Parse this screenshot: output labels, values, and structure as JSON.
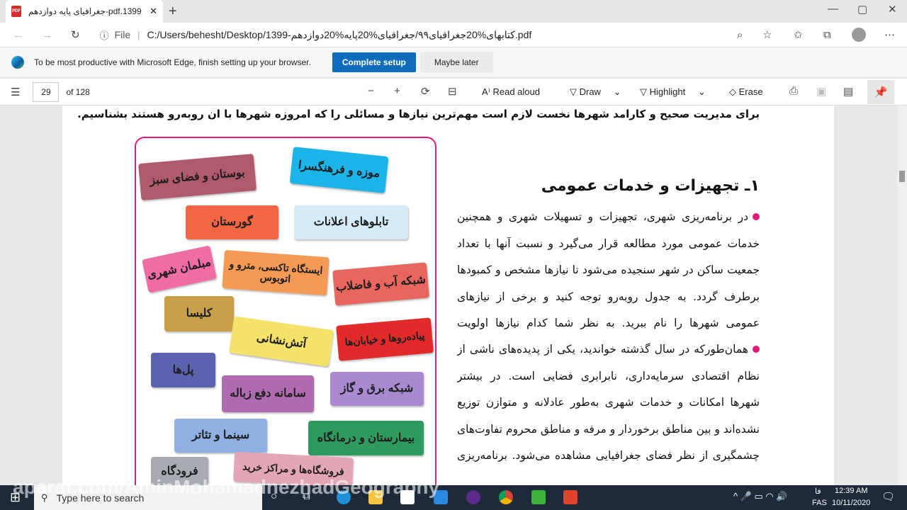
{
  "browser": {
    "tab_title": "جغرافیای پایه دوازدهم-pdf.1399",
    "url_scheme": "File",
    "url": "C:/Users/behesht/Desktop/1399-کتابهای%20جغرافیای۹۹/جغرافیای%20پایه%20دوازدهم.pdf"
  },
  "banner": {
    "text": "To be most productive with Microsoft Edge, finish setting up your browser.",
    "complete": "Complete setup",
    "later": "Maybe later"
  },
  "pdf": {
    "page": "29",
    "of": "of 128",
    "read_aloud": "Read aloud",
    "draw": "Draw",
    "highlight": "Highlight",
    "erase": "Erase"
  },
  "content": {
    "intro": "برای مدیریت صحیح و کارامد شهرها نخست لازم است مهم‌ترین نیازها و مسائلی را که امروزه شهرها با ان روبه‌رو هستند بشناسیم.",
    "heading": "۱ـ تجهیزات و خدمات عمومی",
    "para1": "در برنامه‌ریزی شهری، تجهیزات و تسهیلات شهری و همچنین خدمات عمومی مورد مطالعه قرار می‌گیرد و نسبت آنها با تعداد جمعیت ساکن در شهر سنجیده می‌شود تا نیازها مشخص و کمبودها برطرف گردد. به جدول روبه‌رو توجه کنید و برخی از نیازهای عمومی شهرها را نام ببرید. به نظر شما کدام نیازها اولویت بیشتری دارند. چرا؟",
    "para2": "همان‌طورکه در سال گذشته خواندید، یکی از پدیده‌های ناشی از نظام اقتصادی سرمایه‌داری، نابرابری فضایی است. در بیشتر شهرها امکانات و خدمات شهری به‌طور عادلانه و متوازن توزیع نشده‌اند و بین مناطق برخوردار و مرفه و مناطق محروم تفاوت‌های چشمگیری از نظر فضای جغرافیایی مشاهده می‌شود. برنامه‌ریزی",
    "labels": [
      "بوستان و فضای سبز",
      "موزه و فرهنگسرا",
      "گورستان",
      "تابلوهای اعلانات",
      "مبلمان شهری",
      "ایستگاه تاکسی، مترو و اتوبوس",
      "شبکه آب و فاضلاب",
      "کلیسا",
      "آتش‌نشانی",
      "پیاده‌روها و خیابان‌ها",
      "پل‌ها",
      "سامانه دفع زباله",
      "شبکه برق و گاز",
      "سینما و تئاتر",
      "بیمارستان و درمانگاه",
      "فرودگاه",
      "فروشگاه‌ها و مراکز خرید"
    ]
  },
  "watermark": "aparat.com/AminMohamadnezhadGeography",
  "taskbar": {
    "search_placeholder": "Type here to search",
    "lang1": "فا",
    "lang2": "FAS",
    "time": "12:39 AM",
    "date": "10/11/2020"
  },
  "colors": {
    "accent": "#0f6cbd",
    "frame": "#e0197a"
  }
}
